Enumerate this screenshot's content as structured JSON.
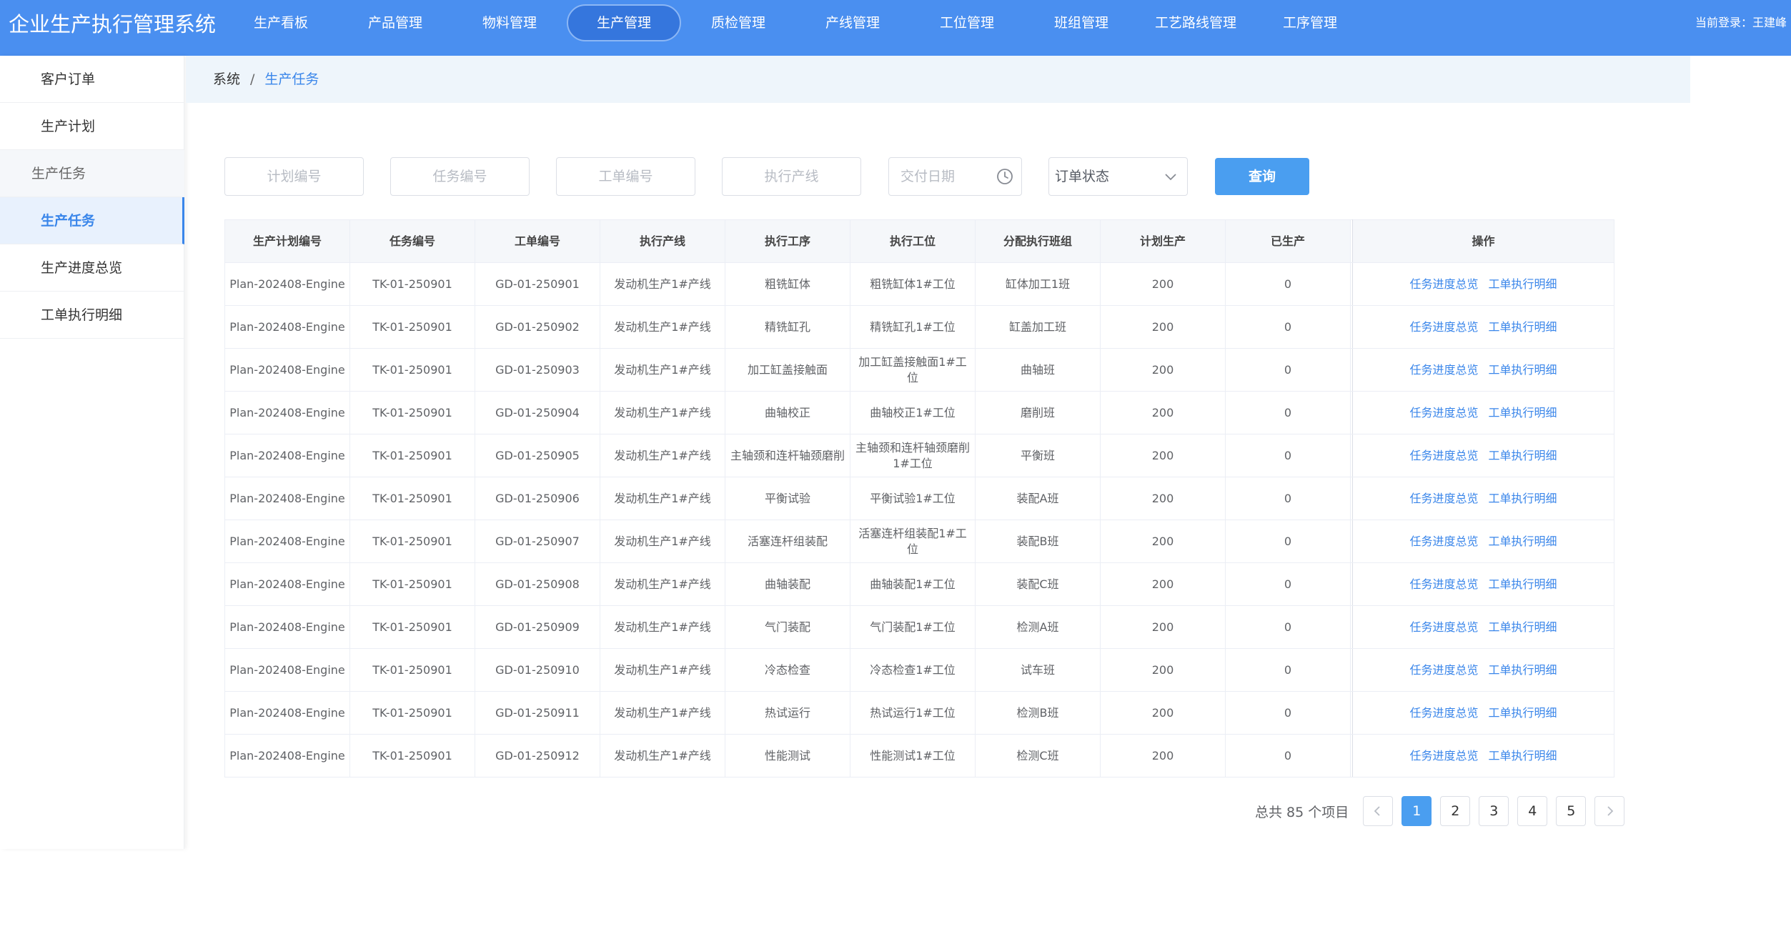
{
  "app": {
    "title": "企业生产执行管理系统",
    "login": "当前登录：王建峰"
  },
  "nav": [
    "生产看板",
    "产品管理",
    "物料管理",
    "生产管理",
    "质检管理",
    "产线管理",
    "工位管理",
    "班组管理",
    "工艺路线管理",
    "工序管理"
  ],
  "nav_active": 3,
  "sidebar": {
    "items": [
      "客户订单",
      "生产计划",
      "生产任务",
      "生产任务",
      "生产进度总览",
      "工单执行明细"
    ]
  },
  "breadcrumb": {
    "root": "系统",
    "current": "生产任务"
  },
  "filters": {
    "plan_no": "计划编号",
    "task_no": "任务编号",
    "order_no": "工单编号",
    "line": "执行产线",
    "due_date": "交付日期",
    "status": "订单状态",
    "query": "查询"
  },
  "table": {
    "headers": [
      "生产计划编号",
      "任务编号",
      "工单编号",
      "执行产线",
      "执行工序",
      "执行工位",
      "分配执行班组",
      "计划生产",
      "已生产",
      "操作"
    ],
    "op_progress": "任务进度总览",
    "op_detail": "工单执行明细",
    "rows": [
      [
        "Plan-202408-Engine",
        "TK-01-250901",
        "GD-01-250901",
        "发动机生产1#产线",
        "粗铣缸体",
        "粗铣缸体1#工位",
        "缸体加工1班",
        "200",
        "0"
      ],
      [
        "Plan-202408-Engine",
        "TK-01-250901",
        "GD-01-250902",
        "发动机生产1#产线",
        "精铣缸孔",
        "精铣缸孔1#工位",
        "缸盖加工班",
        "200",
        "0"
      ],
      [
        "Plan-202408-Engine",
        "TK-01-250901",
        "GD-01-250903",
        "发动机生产1#产线",
        "加工缸盖接触面",
        "加工缸盖接触面1#工位",
        "曲轴班",
        "200",
        "0"
      ],
      [
        "Plan-202408-Engine",
        "TK-01-250901",
        "GD-01-250904",
        "发动机生产1#产线",
        "曲轴校正",
        "曲轴校正1#工位",
        "磨削班",
        "200",
        "0"
      ],
      [
        "Plan-202408-Engine",
        "TK-01-250901",
        "GD-01-250905",
        "发动机生产1#产线",
        "主轴颈和连杆轴颈磨削",
        "主轴颈和连杆轴颈磨削1#工位",
        "平衡班",
        "200",
        "0"
      ],
      [
        "Plan-202408-Engine",
        "TK-01-250901",
        "GD-01-250906",
        "发动机生产1#产线",
        "平衡试验",
        "平衡试验1#工位",
        "装配A班",
        "200",
        "0"
      ],
      [
        "Plan-202408-Engine",
        "TK-01-250901",
        "GD-01-250907",
        "发动机生产1#产线",
        "活塞连杆组装配",
        "活塞连杆组装配1#工位",
        "装配B班",
        "200",
        "0"
      ],
      [
        "Plan-202408-Engine",
        "TK-01-250901",
        "GD-01-250908",
        "发动机生产1#产线",
        "曲轴装配",
        "曲轴装配1#工位",
        "装配C班",
        "200",
        "0"
      ],
      [
        "Plan-202408-Engine",
        "TK-01-250901",
        "GD-01-250909",
        "发动机生产1#产线",
        "气门装配",
        "气门装配1#工位",
        "检测A班",
        "200",
        "0"
      ],
      [
        "Plan-202408-Engine",
        "TK-01-250901",
        "GD-01-250910",
        "发动机生产1#产线",
        "冷态检查",
        "冷态检查1#工位",
        "试车班",
        "200",
        "0"
      ],
      [
        "Plan-202408-Engine",
        "TK-01-250901",
        "GD-01-250911",
        "发动机生产1#产线",
        "热试运行",
        "热试运行1#工位",
        "检测B班",
        "200",
        "0"
      ],
      [
        "Plan-202408-Engine",
        "TK-01-250901",
        "GD-01-250912",
        "发动机生产1#产线",
        "性能测试",
        "性能测试1#工位",
        "检测C班",
        "200",
        "0"
      ]
    ]
  },
  "pagination": {
    "total": "总共 85 个项目",
    "pages": [
      "1",
      "2",
      "3",
      "4",
      "5"
    ],
    "current": 0
  },
  "colors": {
    "header": "#4a8ff0",
    "accent": "#3a86ea",
    "button": "#4a9ef0"
  }
}
